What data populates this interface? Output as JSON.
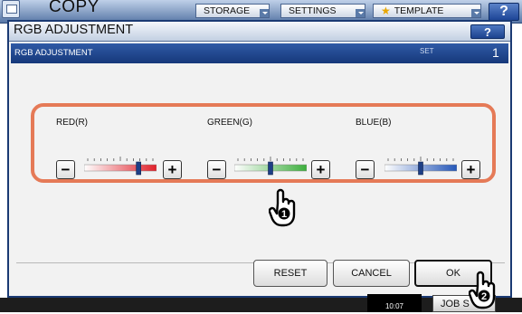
{
  "app": {
    "title": "COPY",
    "tabs": [
      {
        "label": "STORAGE"
      },
      {
        "label": "SETTINGS"
      },
      {
        "label": "TEMPLATE"
      }
    ],
    "help_label": "?"
  },
  "dialog": {
    "title": "RGB ADJUSTMENT",
    "help_label": "?",
    "subheader": "RGB ADJUSTMENT",
    "set_label": "SET",
    "set_number": "1"
  },
  "sliders": [
    {
      "label": "RED(R)",
      "minus": "−",
      "plus": "+",
      "level": 0.78,
      "color": "#e0202a"
    },
    {
      "label": "GREEN(G)",
      "minus": "−",
      "plus": "+",
      "level": 0.5,
      "color": "#3cae3c"
    },
    {
      "label": "BLUE(B)",
      "minus": "−",
      "plus": "+",
      "level": 0.5,
      "color": "#2456b8"
    }
  ],
  "callouts": {
    "one": "1",
    "two": "2"
  },
  "buttons": {
    "reset": "RESET",
    "cancel": "CANCEL",
    "ok": "OK"
  },
  "footer": {
    "job_label": "JOB S",
    "time": "10:07"
  },
  "colors": {
    "accent": "#1b3a73",
    "highlight_frame": "#e57a57"
  }
}
